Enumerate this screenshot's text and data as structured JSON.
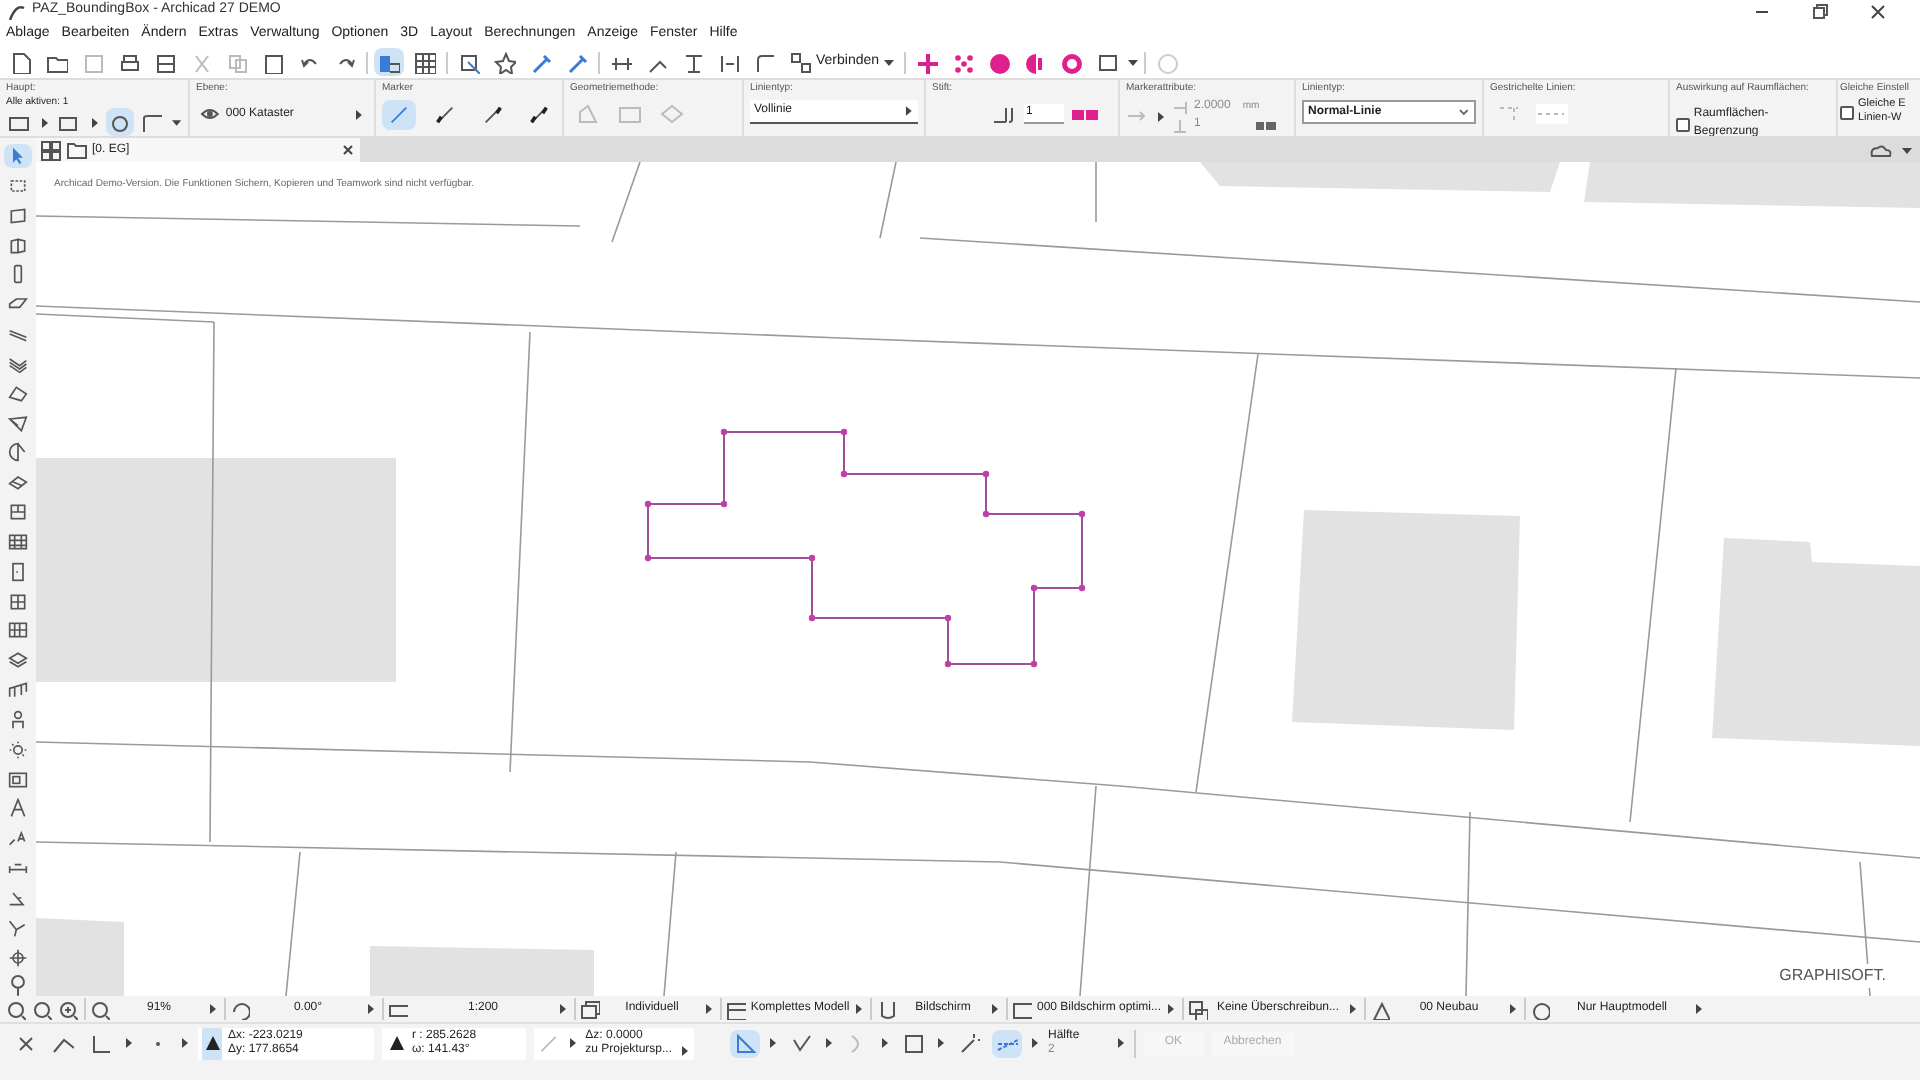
{
  "window": {
    "title": "PAZ_BoundingBox - Archicad 27 DEMO"
  },
  "menu": [
    "Ablage",
    "Bearbeiten",
    "Ändern",
    "Extras",
    "Verwaltung",
    "Optionen",
    "3D",
    "Layout",
    "Berechnungen",
    "Anzeige",
    "Fenster",
    "Hilfe"
  ],
  "toolbar": {
    "view_toggles": [
      {
        "selected": true
      },
      {
        "selected": false
      }
    ],
    "connect_label": "Verbinden"
  },
  "info_box": {
    "main": {
      "heading": "Haupt:",
      "selection": "Alle aktiven: 1"
    },
    "layer": {
      "heading": "Ebene:",
      "value": "000 Kataster"
    },
    "marker": {
      "heading": "Marker",
      "options": [
        {
          "selected": true
        },
        {
          "selected": false
        },
        {
          "selected": false
        },
        {
          "selected": false
        }
      ]
    },
    "geometry": {
      "heading": "Geometriemethode:"
    },
    "line_type": {
      "heading": "Linientyp:",
      "value": "Vollinie"
    },
    "pen": {
      "heading": "Stift:",
      "value": "1"
    },
    "marker_attributes": {
      "heading": "Markerattribute:",
      "size": "2.0000",
      "unit": "mm",
      "pen": "1"
    },
    "line_category": {
      "heading": "Linientyp:",
      "value": "Normal-Linie"
    },
    "dashed": {
      "heading": "Gestrichelte Linien:"
    },
    "zones": {
      "heading": "Auswirkung auf Raumflächen:",
      "label": "Raumflächen-Begrenzung",
      "checked": false
    },
    "same": {
      "heading": "Gleiche Einstell",
      "label_1": "Gleiche E",
      "label_2": "Linien-W",
      "checked": false
    }
  },
  "tabs": [
    {
      "label": "[0. EG]",
      "selected": true
    }
  ],
  "notice": "Archicad Demo-Version. Die Funktionen Sichern, Kopieren und Teamwork sind nicht verfügbar.",
  "toolbox": [
    {
      "selected": true
    },
    {
      "selected": false
    },
    {
      "selected": false
    },
    {
      "selected": false
    },
    {
      "selected": false
    },
    {
      "selected": false
    },
    {
      "selected": false
    },
    {
      "selected": false
    },
    {
      "selected": false
    },
    {
      "selected": false
    },
    {
      "selected": false
    },
    {
      "selected": false
    },
    {
      "selected": false
    },
    {
      "selected": false
    },
    {
      "selected": false
    },
    {
      "selected": false
    },
    {
      "selected": false
    },
    {
      "selected": false
    },
    {
      "selected": false
    },
    {
      "selected": false
    },
    {
      "selected": false
    },
    {
      "selected": false
    },
    {
      "selected": false
    },
    {
      "selected": false
    },
    {
      "selected": false
    },
    {
      "selected": false
    },
    {
      "selected": false
    },
    {
      "selected": false
    }
  ],
  "canvas": {
    "brand": "GRAPHISOFT."
  },
  "status_bar": {
    "zoom": "91%",
    "angle": "0.00°",
    "scale": "1:200",
    "model_view": "Individuell",
    "model": "Komplettes Modell",
    "pen_set": "Bildschirm",
    "override": "000 Bildschirm optimi...",
    "graphic_override": "Keine Überschreibun...",
    "renovation": "00 Neubau",
    "structure": "Nur Hauptmodell"
  },
  "coordinates": {
    "dx": "Δx: -223.0219",
    "dy": "Δy: 177.8654",
    "r": "r : 285.2628",
    "angle": "ω: 141.43°",
    "dz": "Δz: 0.0000",
    "reference": "zu Projektursp...",
    "snap_label": "Hälfte",
    "snap_value": "2"
  },
  "actions": [
    {
      "label": "OK",
      "disabled": true
    },
    {
      "label": "Abbrechen",
      "disabled": true
    }
  ]
}
